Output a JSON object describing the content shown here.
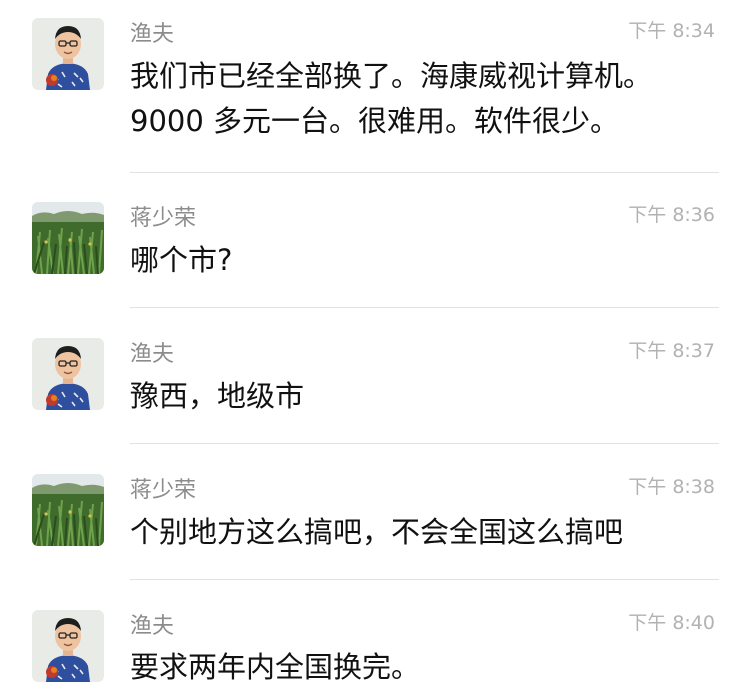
{
  "messages": [
    {
      "sender": "渔夫",
      "avatar": "cartoon-man-avatar",
      "time": "下午 8:34",
      "text": "我们市已经全部换了。海康威视计算机。9000 多元一台。很难用。软件很少。"
    },
    {
      "sender": "蒋少荣",
      "avatar": "grass-photo-avatar",
      "time": "下午 8:36",
      "text": "哪个市?"
    },
    {
      "sender": "渔夫",
      "avatar": "cartoon-man-avatar",
      "time": "下午 8:37",
      "text": "豫西，地级市"
    },
    {
      "sender": "蒋少荣",
      "avatar": "grass-photo-avatar",
      "time": "下午 8:38",
      "text": "个别地方这么搞吧，不会全国这么搞吧"
    },
    {
      "sender": "渔夫",
      "avatar": "cartoon-man-avatar",
      "time": "下午 8:40",
      "text": "要求两年内全国换完。"
    }
  ]
}
